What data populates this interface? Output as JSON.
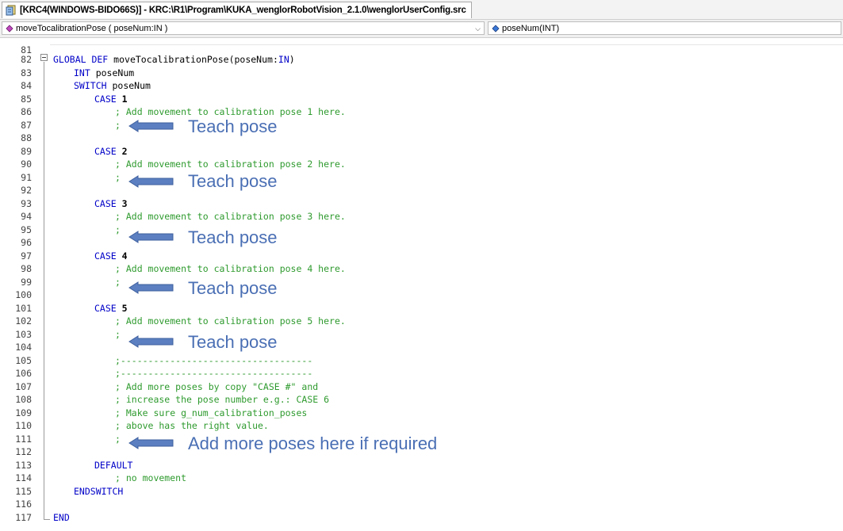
{
  "window": {
    "tab_title": "[KRC4(WINDOWS-BIDO66S)] - KRC:\\R1\\Program\\KUKA_wenglorRobotVision_2.1.0\\wenglorUserConfig.src",
    "tab_icon": "document-icon"
  },
  "navigation": {
    "member_combo": "moveTocalibrationPose ( poseNum:IN )",
    "param_combo": "poseNum(INT)"
  },
  "colors": {
    "keyword": "#0000c8",
    "comment": "#2e9a2e",
    "annotation": "#4a6fb4",
    "arrow": "#5b7fc0"
  },
  "editor": {
    "line_numbers": [
      "81",
      "82",
      "83",
      "84",
      "85",
      "86",
      "87",
      "88",
      "89",
      "90",
      "91",
      "92",
      "93",
      "94",
      "95",
      "96",
      "97",
      "98",
      "99",
      "100",
      "101",
      "102",
      "103",
      "104",
      "105",
      "106",
      "107",
      "108",
      "109",
      "110",
      "111",
      "112",
      "113",
      "114",
      "115",
      "116",
      "117"
    ],
    "code": {
      "l82": {
        "kw1": "GLOBAL DEF",
        "name": " moveTocalibrationPose(poseNum:",
        "kw2": "IN",
        "close": ")"
      },
      "l83": {
        "kw": "INT",
        "rest": " poseNum"
      },
      "l84": {
        "kw": "SWITCH",
        "rest": " poseNum"
      },
      "l85": {
        "kw": "CASE",
        "num": " 1"
      },
      "l86": "; Add movement to calibration pose 1 here.",
      "l87": ";",
      "l89": {
        "kw": "CASE",
        "num": " 2"
      },
      "l90": "; Add movement to calibration pose 2 here.",
      "l91": ";",
      "l93": {
        "kw": "CASE",
        "num": " 3"
      },
      "l94": "; Add movement to calibration pose 3 here.",
      "l95": ";",
      "l97": {
        "kw": "CASE",
        "num": " 4"
      },
      "l98": "; Add movement to calibration pose 4 here.",
      "l99": ";",
      "l101": {
        "kw": "CASE",
        "num": " 5"
      },
      "l102": "; Add movement to calibration pose 5 here.",
      "l103": ";",
      "l105": ";-----------------------------------",
      "l106": ";-----------------------------------",
      "l107": "; Add more poses by copy \"CASE #\" and",
      "l108": "; increase the pose number e.g.: CASE 6",
      "l109": "; Make sure g_num_calibration_poses",
      "l110": "; above has the right value.",
      "l111": ";",
      "l113": "DEFAULT",
      "l114": "; no movement",
      "l115": "ENDSWITCH",
      "l117": "END"
    }
  },
  "annotations": {
    "teach_pose": "Teach pose",
    "add_more": "Add more poses here if required"
  }
}
